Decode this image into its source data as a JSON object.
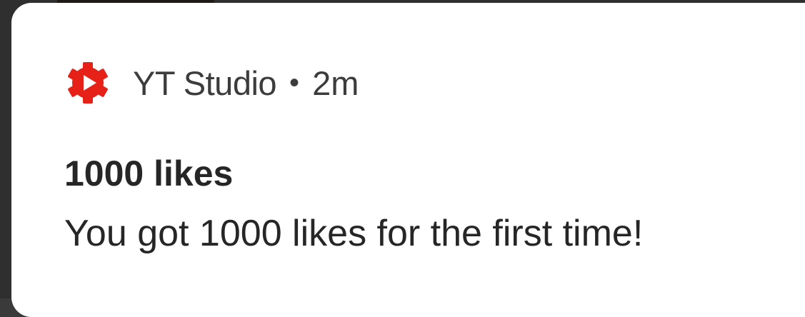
{
  "notification": {
    "app_name": "YT Studio",
    "separator": "•",
    "time": "2m",
    "title": "1000 likes",
    "body": "You got 1000 likes for the first time!",
    "icon": "yt-studio-gear-play-icon",
    "icon_color": "#e62117"
  }
}
